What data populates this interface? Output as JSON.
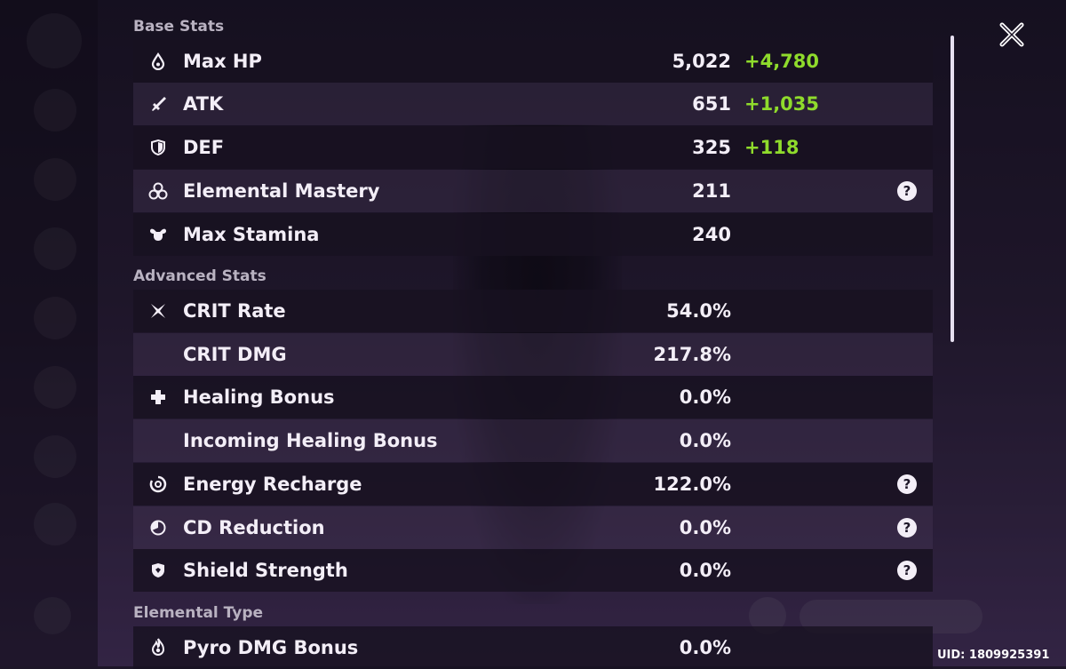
{
  "sections": {
    "base": "Base Stats",
    "advanced": "Advanced Stats",
    "elemental": "Elemental Type"
  },
  "base_stats": [
    {
      "label": "Max HP",
      "value": "5,022",
      "bonus": "+4,780",
      "icon": "hp-drop-icon"
    },
    {
      "label": "ATK",
      "value": "651",
      "bonus": "+1,035",
      "icon": "sword-icon"
    },
    {
      "label": "DEF",
      "value": "325",
      "bonus": "+118",
      "icon": "shield-icon"
    },
    {
      "label": "Elemental Mastery",
      "value": "211",
      "icon": "mastery-icon",
      "help": "?"
    },
    {
      "label": "Max Stamina",
      "value": "240",
      "icon": "stamina-icon"
    }
  ],
  "advanced_stats": [
    {
      "label": "CRIT Rate",
      "value": "54.0%",
      "icon": "crit-rate-icon"
    },
    {
      "label": "CRIT DMG",
      "value": "217.8%"
    },
    {
      "label": "Healing Bonus",
      "value": "0.0%",
      "icon": "healing-cross-icon"
    },
    {
      "label": "Incoming Healing Bonus",
      "value": "0.0%"
    },
    {
      "label": "Energy Recharge",
      "value": "122.0%",
      "icon": "energy-recharge-icon",
      "help": "?"
    },
    {
      "label": "CD Reduction",
      "value": "0.0%",
      "icon": "cd-reduction-icon",
      "help": "?"
    },
    {
      "label": "Shield Strength",
      "value": "0.0%",
      "icon": "shield-strength-icon",
      "help": "?"
    }
  ],
  "elemental_stats": [
    {
      "label": "Pyro DMG Bonus",
      "value": "0.0%",
      "icon": "pyro-icon"
    }
  ],
  "uid": "UID: 1809925391",
  "colors": {
    "bonus": "#8fdb2c",
    "text": "#f3eef7",
    "section": "#b9b2c1"
  }
}
